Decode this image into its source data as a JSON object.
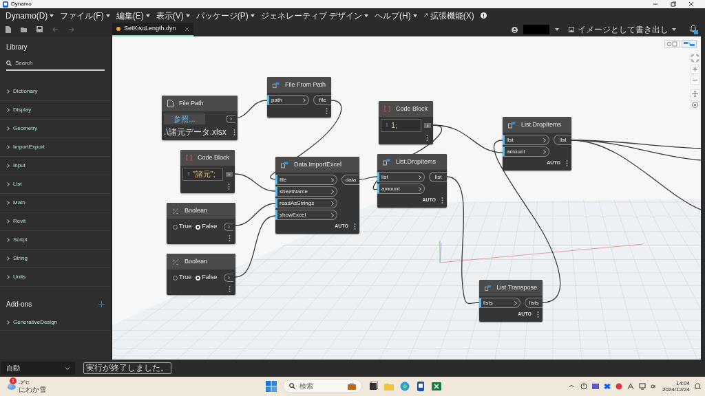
{
  "window": {
    "title": "Dynamo"
  },
  "menu": [
    {
      "label": "Dynamo(D)",
      "kind": "dropdown"
    },
    {
      "label": "ファイル(F)",
      "kind": "dropdown"
    },
    {
      "label": "編集(E)",
      "kind": "dropdown"
    },
    {
      "label": "表示(V)",
      "kind": "dropdown"
    },
    {
      "label": "パッケージ(P)",
      "kind": "dropdown"
    },
    {
      "label": "ジェネレーティブ デザイン",
      "kind": "dropdown"
    },
    {
      "label": "ヘルプ(H)",
      "kind": "dropdown"
    },
    {
      "label": "拡張機能(X)",
      "kind": "extensions"
    }
  ],
  "toolbar": [
    {
      "kind": "new",
      "disabled": false
    },
    {
      "kind": "open",
      "disabled": false
    },
    {
      "kind": "save",
      "disabled": false
    },
    {
      "kind": "undo",
      "disabled": true
    },
    {
      "kind": "redo",
      "disabled": true
    }
  ],
  "tab": {
    "label": "SetKisoLength.dyn",
    "unsaved": true,
    "selected": true
  },
  "export_button": {
    "label": "イメージとして書き出し"
  },
  "library": {
    "title": "Library",
    "search": {
      "placeholder": "Search"
    },
    "categories": [
      "Dictionary",
      "Display",
      "Geometry",
      "ImportExport",
      "Input",
      "List",
      "Math",
      "Revit",
      "Script",
      "String",
      "Units"
    ],
    "addons_title": "Add-ons",
    "addons": [
      "GenerativeDesign"
    ]
  },
  "nodes": [
    {
      "kind": "file_path",
      "title": "File Path",
      "button": "参照...",
      "path": ".\\諸元データ.xlsx"
    },
    {
      "kind": "code_block",
      "title": "Code Block",
      "lines": [
        {
          "number": "1",
          "code": "\"諸元\";"
        }
      ]
    },
    {
      "kind": "boolean",
      "title": "Boolean",
      "options": [
        {
          "label": "True",
          "selected": false
        },
        {
          "label": "False",
          "selected": true
        }
      ]
    },
    {
      "kind": "boolean",
      "title": "Boolean",
      "options": [
        {
          "label": "True",
          "selected": false
        },
        {
          "label": "False",
          "selected": true
        }
      ]
    },
    {
      "kind": "function",
      "title": "File From Path",
      "inputs": [
        "path"
      ],
      "outputs": [
        "file"
      ]
    },
    {
      "kind": "function",
      "title": "Data.ImportExcel",
      "inputs": [
        "file",
        "sheetName",
        "readAsStrings",
        "showExcel"
      ],
      "outputs": [
        "data"
      ],
      "lacing": "AUTO"
    },
    {
      "kind": "code_block",
      "title": "Code Block",
      "lines": [
        {
          "number": "1",
          "code": "1;"
        }
      ]
    },
    {
      "kind": "function",
      "title": "List.DropItems",
      "inputs": [
        "list",
        "amount"
      ],
      "outputs": [
        "list"
      ],
      "lacing": "AUTO"
    },
    {
      "kind": "function",
      "title": "List.DropItems",
      "inputs": [
        "list",
        "amount"
      ],
      "outputs": [
        "list"
      ],
      "lacing": "AUTO"
    },
    {
      "kind": "function",
      "title": "List.Transpose",
      "inputs": [
        "lists"
      ],
      "outputs": [
        "lists"
      ],
      "lacing": "AUTO"
    }
  ],
  "status_bar": {
    "run_mode": "自動",
    "message": "実行が終了しました。"
  },
  "taskbar": {
    "weather": {
      "temperature": "-2°C",
      "condition": "にわか雪",
      "badge": "1"
    },
    "search": {
      "placeholder": "検索"
    },
    "clock": {
      "time": "14:04",
      "date": "2024/12/24"
    }
  }
}
